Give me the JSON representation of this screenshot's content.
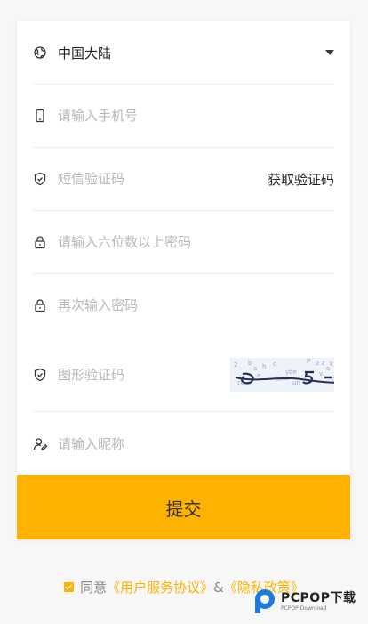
{
  "form": {
    "region_label": "中国大陆",
    "phone_placeholder": "请输入手机号",
    "sms_placeholder": "短信验证码",
    "sms_button": "获取验证码",
    "password_placeholder": "请输入六位数以上密码",
    "confirm_placeholder": "再次输入密码",
    "captcha_placeholder": "图形验证码",
    "nickname_placeholder": "请输入昵称",
    "submit_label": "提交"
  },
  "agreement": {
    "checked": true,
    "prefix": "同意",
    "terms_link": "《用户服务协议》",
    "joiner": "&",
    "privacy_link": "《隐私政策》"
  },
  "watermark": {
    "brand": "PCPOP下载",
    "sub": "PCPOP Download"
  },
  "colors": {
    "accent": "#ffb300",
    "placeholder": "#b8b8b8"
  },
  "icons": {
    "region": "globe-icon",
    "phone": "phone-icon",
    "sms": "shield-check-icon",
    "password": "lock-icon",
    "confirm": "lock-icon",
    "captcha": "shield-check-icon",
    "nickname": "user-edit-icon"
  }
}
